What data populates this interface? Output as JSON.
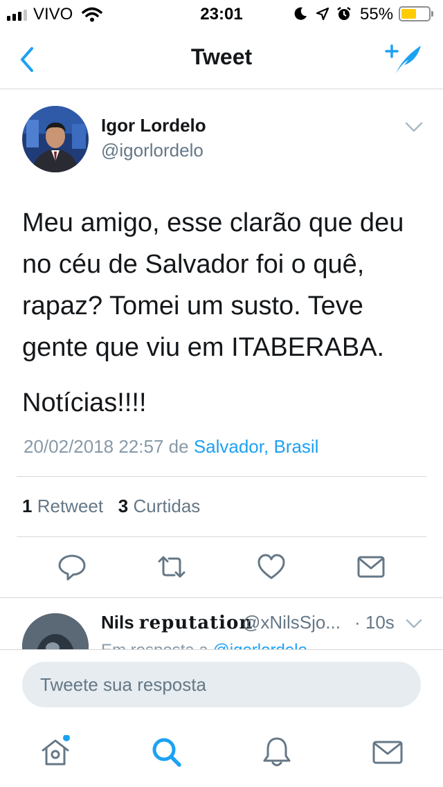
{
  "status_bar": {
    "carrier": "VIVO",
    "time": "23:01",
    "battery_percent": "55%",
    "battery_level": 0.55,
    "battery_color": "#ffcc00"
  },
  "nav": {
    "title": "Tweet",
    "back_icon": "chevron-left-icon",
    "compose_icon": "compose-tweet-icon"
  },
  "tweet": {
    "author_name": "Igor Lordelo",
    "author_handle": "@igorlordelo",
    "paragraphs": [
      "Meu amigo, esse clarão que deu no céu de Salvador foi o quê, rapaz? Tomei um susto. Teve gente que viu em ITABERABA.",
      "Notícias!!!!"
    ],
    "timestamp": "20/02/2018 22:57",
    "from_label": "de",
    "location": "Salvador, Brasil",
    "retweet_count": "1",
    "retweet_label": "Retweet",
    "like_count": "3",
    "like_label": "Curtidas"
  },
  "actions": [
    "reply-icon",
    "retweet-icon",
    "like-icon",
    "direct-message-icon"
  ],
  "reply_preview": {
    "name": "Nils",
    "name_styled": "reputation",
    "handle": "@xNilsSjo...",
    "time": "· 10s",
    "context_prefix": "Em resposta a",
    "context_mention": "@igorlordelo"
  },
  "composer": {
    "placeholder": "Tweete sua resposta"
  },
  "tab_bar": [
    "home-icon",
    "search-icon",
    "notifications-icon",
    "messages-icon"
  ],
  "colors": {
    "accent": "#1da1f2",
    "secondary_text": "#657786",
    "divider": "#d6d6d6"
  }
}
